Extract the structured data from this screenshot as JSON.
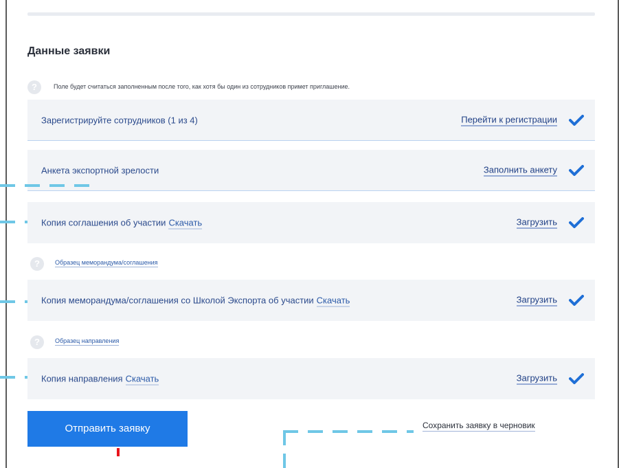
{
  "section": {
    "title": "Данные заявки",
    "hint": "Поле будет считаться заполненным после того, как хотя бы один из сотрудников примет приглашение."
  },
  "question_icon": "?",
  "rows": [
    {
      "label": "Зарегистрируйте сотрудников (1 из 4)",
      "download": "",
      "action": "Перейти к регистрации",
      "status_icon": "check-icon"
    },
    {
      "label": "Анкета экспортной зрелости",
      "download": "",
      "action": "Заполнить анкету",
      "status_icon": "check-icon"
    },
    {
      "label": "Копия соглашения об участии",
      "download": "Скачать",
      "action": "Загрузить",
      "status_icon": "check-icon"
    },
    {
      "label": "Копия меморандума/соглашения со Школой Экспорта об участии",
      "download": "Скачать",
      "action": "Загрузить",
      "status_icon": "check-icon"
    },
    {
      "label": "Копия направления",
      "download": "Скачать",
      "action": "Загрузить",
      "status_icon": "check-icon"
    }
  ],
  "samples": {
    "memorandum": "Образец меморандума/соглашения",
    "direction": "Образец направления"
  },
  "footer": {
    "submit_label": "Отправить заявку",
    "draft_label": "Сохранить заявку в черновик"
  },
  "colors": {
    "accent": "#1f7ae6",
    "check": "#1f6fd6",
    "annotation_dash": "#6fc7e6",
    "annotation_marker": "#e8141c"
  }
}
